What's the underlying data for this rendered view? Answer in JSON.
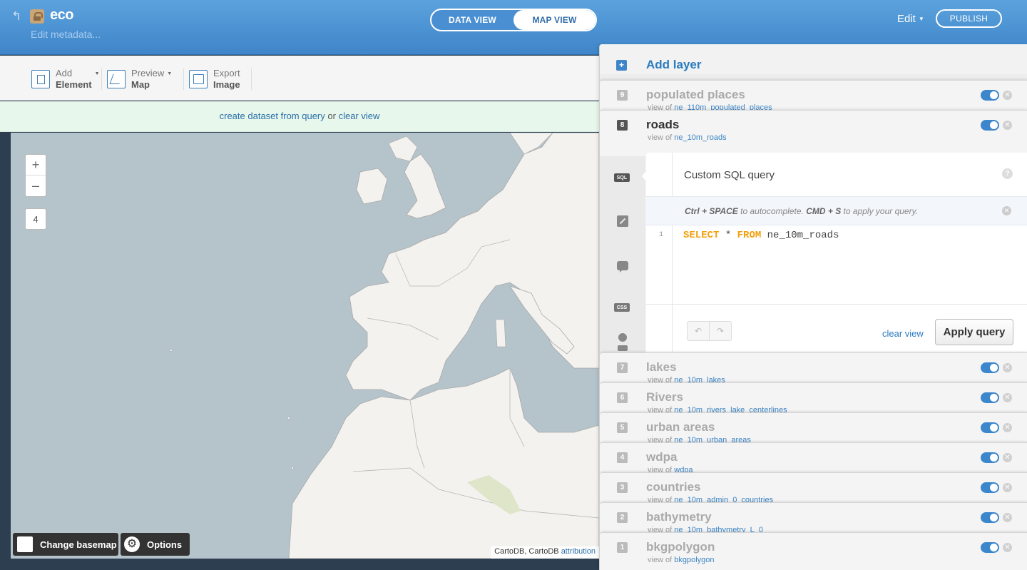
{
  "header": {
    "title": "eco",
    "edit_metadata": "Edit metadata...",
    "views": [
      "DATA VIEW",
      "MAP VIEW"
    ],
    "active_view": "MAP VIEW",
    "edit_menu": "Edit",
    "publish": "PUBLISH"
  },
  "toolbar": {
    "add_element": [
      "Add",
      "Element"
    ],
    "preview_map": [
      "Preview",
      "Map"
    ],
    "export_image": [
      "Export",
      "Image"
    ]
  },
  "query_bar": {
    "create_link": "create dataset from query",
    "or": "or",
    "clear_link": "clear view"
  },
  "map": {
    "zoom_in": "+",
    "zoom_out": "–",
    "zoom_level": "4",
    "change_basemap": "Change basemap",
    "options": "Options",
    "attribution_prefix": "CartoDB, CartoDB",
    "attribution_link": "attribution",
    "colors": {
      "sea": "#b5c3ca",
      "land": "#f3f2ee",
      "border": "#a9a9a9"
    }
  },
  "panel": {
    "add_layer": "Add layer",
    "view_of": "view of",
    "layers": [
      {
        "num": "9",
        "name": "populated places",
        "source": "ne_110m_populated_places",
        "enabled": true
      },
      {
        "num": "8",
        "name": "roads",
        "source": "ne_10m_roads",
        "enabled": true,
        "active": true
      },
      {
        "num": "7",
        "name": "lakes",
        "source": "ne_10m_lakes",
        "enabled": true
      },
      {
        "num": "6",
        "name": "Rivers",
        "source": "ne_10m_rivers_lake_centerlines",
        "enabled": true
      },
      {
        "num": "5",
        "name": "urban areas",
        "source": "ne_10m_urban_areas",
        "enabled": true
      },
      {
        "num": "4",
        "name": "wdpa",
        "source": "wdpa",
        "enabled": true
      },
      {
        "num": "3",
        "name": "countries",
        "source": "ne_10m_admin_0_countries",
        "enabled": true
      },
      {
        "num": "2",
        "name": "bathymetry",
        "source": "ne_10m_bathymetry_L_0",
        "enabled": true
      },
      {
        "num": "1",
        "name": "bkgpolygon",
        "source": "bkgpolygon",
        "enabled": true
      }
    ],
    "side_tabs": [
      "SQL",
      "wizard-icon",
      "infowindow-icon",
      "CSS",
      "legend-icon"
    ],
    "sql": {
      "title": "Custom SQL query",
      "help": "?",
      "hint_keys1": "Ctrl + SPACE",
      "hint_mid": " to autocomplete. ",
      "hint_keys2": "CMD + S",
      "hint_end": " to apply your query.",
      "line_number": "1",
      "kw_select": "SELECT",
      "star": " * ",
      "kw_from": "FROM",
      "table": " ne_10m_roads",
      "undo": "↶",
      "redo": "↷",
      "clear_view": "clear view",
      "apply": "Apply query"
    }
  }
}
